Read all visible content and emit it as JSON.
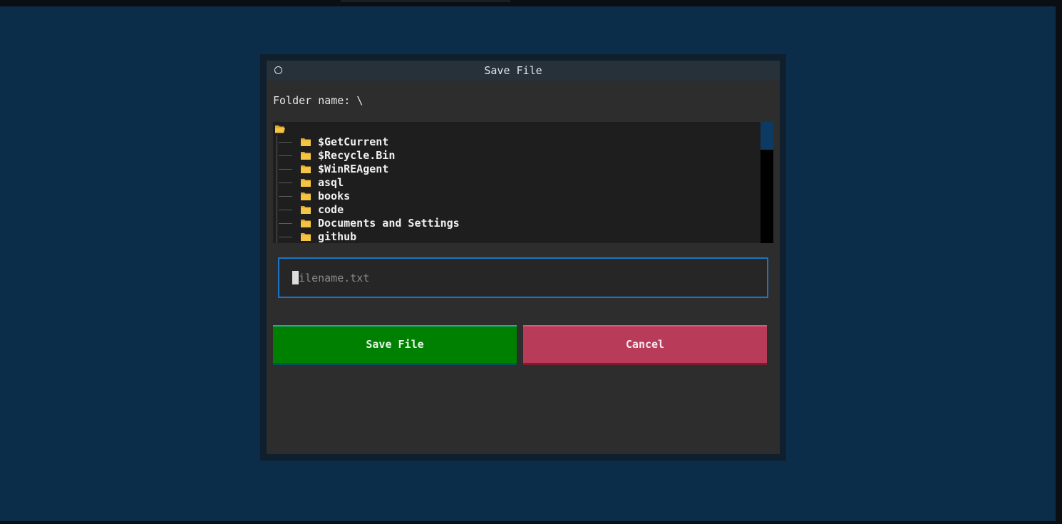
{
  "dialog": {
    "title": "Save File",
    "folder_label": "Folder name: \\"
  },
  "tree": {
    "root_icon": "open-folder-icon",
    "items": [
      {
        "label": "$GetCurrent",
        "icon": "folder-icon"
      },
      {
        "label": "$Recycle.Bin",
        "icon": "folder-icon"
      },
      {
        "label": "$WinREAgent",
        "icon": "folder-icon"
      },
      {
        "label": "asql",
        "icon": "folder-icon"
      },
      {
        "label": "books",
        "icon": "folder-icon"
      },
      {
        "label": "code",
        "icon": "folder-icon"
      },
      {
        "label": "Documents and Settings",
        "icon": "folder-icon"
      },
      {
        "label": "github",
        "icon": "folder-icon"
      }
    ]
  },
  "filename_input": {
    "value": "",
    "placeholder": "filename.txt"
  },
  "buttons": {
    "save_label": "Save File",
    "cancel_label": "Cancel"
  },
  "colors": {
    "background": "#0c2d4a",
    "dialog": "#2d2d2d",
    "save": "#008000",
    "cancel": "#b93b5a",
    "input_border": "#1d74c6",
    "folder": "#f5c443"
  }
}
